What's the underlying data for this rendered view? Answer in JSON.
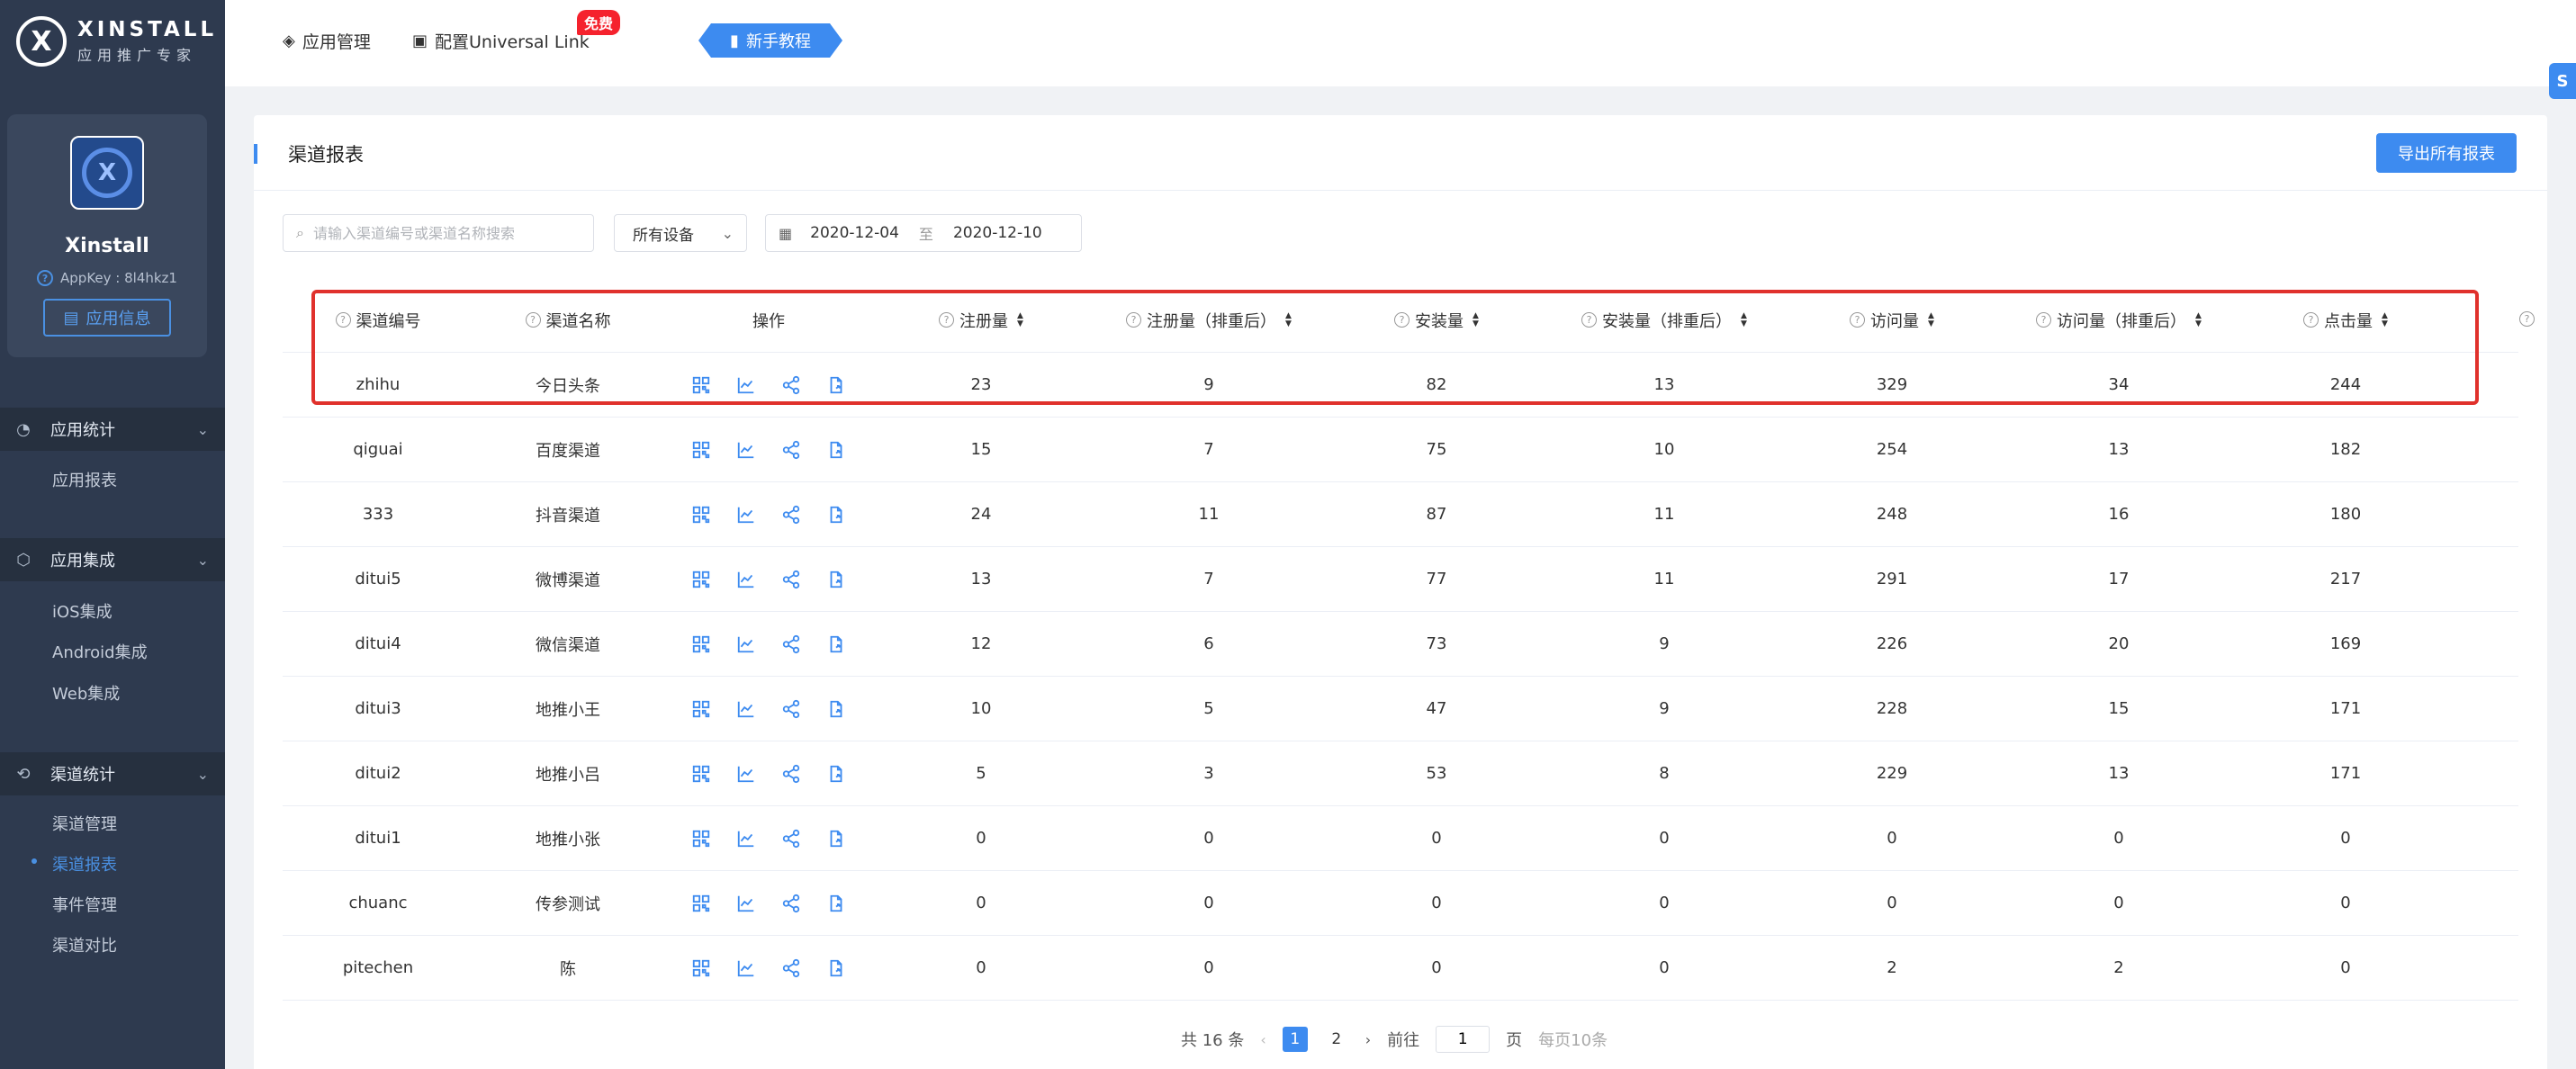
{
  "brand": {
    "title": "XINSTALL",
    "subtitle": "应用推广专家",
    "logo_glyph": "X"
  },
  "app": {
    "name": "Xinstall",
    "appkey": "AppKey : 8l4hkz1",
    "info_button": "应用信息"
  },
  "sidebar": {
    "groups": [
      {
        "label": "应用统计",
        "icon": "pie-chart-icon",
        "items": [
          "应用报表"
        ]
      },
      {
        "label": "应用集成",
        "icon": "hexagon-icon",
        "items": [
          "iOS集成",
          "Android集成",
          "Web集成"
        ]
      },
      {
        "label": "渠道统计",
        "icon": "network-icon",
        "items": [
          "渠道管理",
          "渠道报表",
          "事件管理",
          "渠道对比"
        ]
      }
    ],
    "active_item": "渠道报表"
  },
  "topbar": {
    "app_manage": "应用管理",
    "universal_link": "配置Universal Link",
    "free_badge": "免费",
    "tutorial": "新手教程"
  },
  "panel": {
    "title": "渠道报表",
    "export_button": "导出所有报表",
    "search_placeholder": "请输入渠道编号或渠道名称搜索",
    "device_select": "所有设备",
    "date_start": "2020-12-04",
    "date_sep": "至",
    "date_end": "2020-12-10"
  },
  "table": {
    "headers": [
      "渠道编号",
      "渠道名称",
      "操作",
      "注册量",
      "注册量（排重后）",
      "安装量",
      "安装量（排重后）",
      "访问量",
      "访问量（排重后）",
      "点击量"
    ],
    "rows": [
      [
        "zhihu",
        "今日头条",
        "23",
        "9",
        "82",
        "13",
        "329",
        "34",
        "244"
      ],
      [
        "qiguai",
        "百度渠道",
        "15",
        "7",
        "75",
        "10",
        "254",
        "13",
        "182"
      ],
      [
        "333",
        "抖音渠道",
        "24",
        "11",
        "87",
        "11",
        "248",
        "16",
        "180"
      ],
      [
        "ditui5",
        "微博渠道",
        "13",
        "7",
        "77",
        "11",
        "291",
        "17",
        "217"
      ],
      [
        "ditui4",
        "微信渠道",
        "12",
        "6",
        "73",
        "9",
        "226",
        "20",
        "169"
      ],
      [
        "ditui3",
        "地推小王",
        "10",
        "5",
        "47",
        "9",
        "228",
        "15",
        "171"
      ],
      [
        "ditui2",
        "地推小吕",
        "5",
        "3",
        "53",
        "8",
        "229",
        "13",
        "171"
      ],
      [
        "ditui1",
        "地推小张",
        "0",
        "0",
        "0",
        "0",
        "0",
        "0",
        "0"
      ],
      [
        "chuanc",
        "传参测试",
        "0",
        "0",
        "0",
        "0",
        "0",
        "0",
        "0"
      ],
      [
        "pitechen",
        "陈",
        "0",
        "0",
        "0",
        "0",
        "2",
        "2",
        "0"
      ]
    ]
  },
  "pagination": {
    "total": "共 16 条",
    "pages": [
      "1",
      "2"
    ],
    "current": "1",
    "goto_label": "前往",
    "goto_value": "1",
    "page_unit": "页",
    "per_page": "每页10条"
  },
  "colors": {
    "accent": "#3d8bf0",
    "sidebar": "#2e3a4f",
    "highlight": "#e0312c",
    "badge": "#f5222d"
  }
}
